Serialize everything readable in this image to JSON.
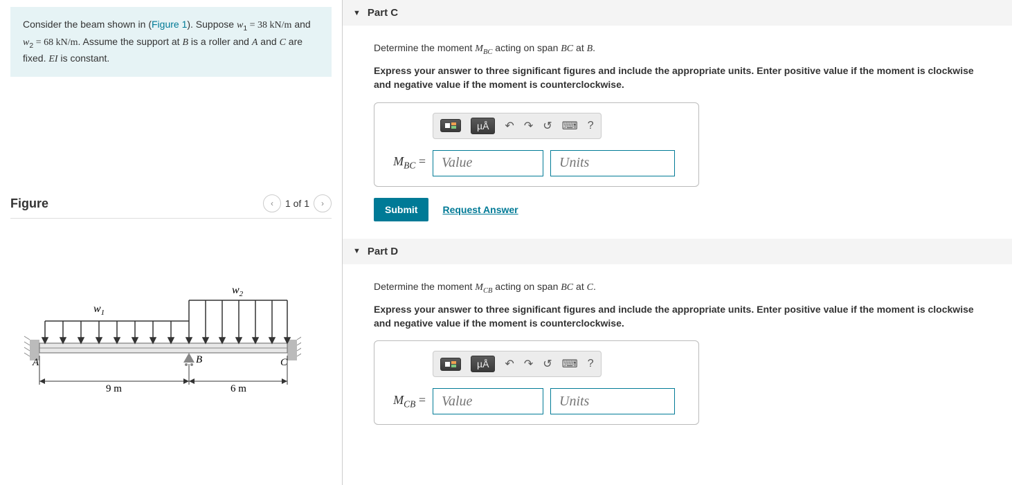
{
  "problem": {
    "text_parts": {
      "p1": "Consider the beam shown in (",
      "fig_link": "Figure 1",
      "p2": "). Suppose ",
      "w1": "w",
      "w1_sub": "1",
      "eq1": " = 38 kN/m",
      "and": " and ",
      "w2": "w",
      "w2_sub": "2",
      "eq2": " = 68 kN/m",
      "p3": ". Assume the support at ",
      "B": "B",
      "p4": " is a roller and ",
      "A": "A",
      "p5": " and ",
      "C": "C",
      "p6": " are fixed. ",
      "EI": "EI",
      "p7": " is constant."
    }
  },
  "figure": {
    "title": "Figure",
    "pager": "1 of 1",
    "labels": {
      "w1": "w",
      "w1s": "1",
      "w2": "w",
      "w2s": "2",
      "A": "A",
      "B": "B",
      "C": "C",
      "d1": "9 m",
      "d2": "6 m"
    }
  },
  "parts": {
    "c": {
      "title": "Part C",
      "instr_pre": "Determine the moment ",
      "var": "M",
      "var_sub": "BC",
      "instr_mid": " acting on span ",
      "span": "BC",
      "instr_at": " at ",
      "pt": "B",
      "instr_end": ".",
      "bold": "Express your answer to three significant figures and include the appropriate units. Enter positive value if the moment is clockwise and negative value if the moment is counterclockwise.",
      "label_var": "M",
      "label_sub": "BC",
      "label_eq": " = ",
      "value_ph": "Value",
      "units_ph": "Units",
      "submit": "Submit",
      "request": "Request Answer"
    },
    "d": {
      "title": "Part D",
      "instr_pre": "Determine the moment ",
      "var": "M",
      "var_sub": "CB",
      "instr_mid": " acting on span ",
      "span": "BC",
      "instr_at": " at ",
      "pt": "C",
      "instr_end": ".",
      "bold": "Express your answer to three significant figures and include the appropriate units. Enter positive value if the moment is clockwise and negative value if the moment is counterclockwise.",
      "label_var": "M",
      "label_sub": "CB",
      "label_eq": " = ",
      "value_ph": "Value",
      "units_ph": "Units"
    }
  },
  "toolbar": {
    "mu": "µÅ",
    "help": "?"
  }
}
